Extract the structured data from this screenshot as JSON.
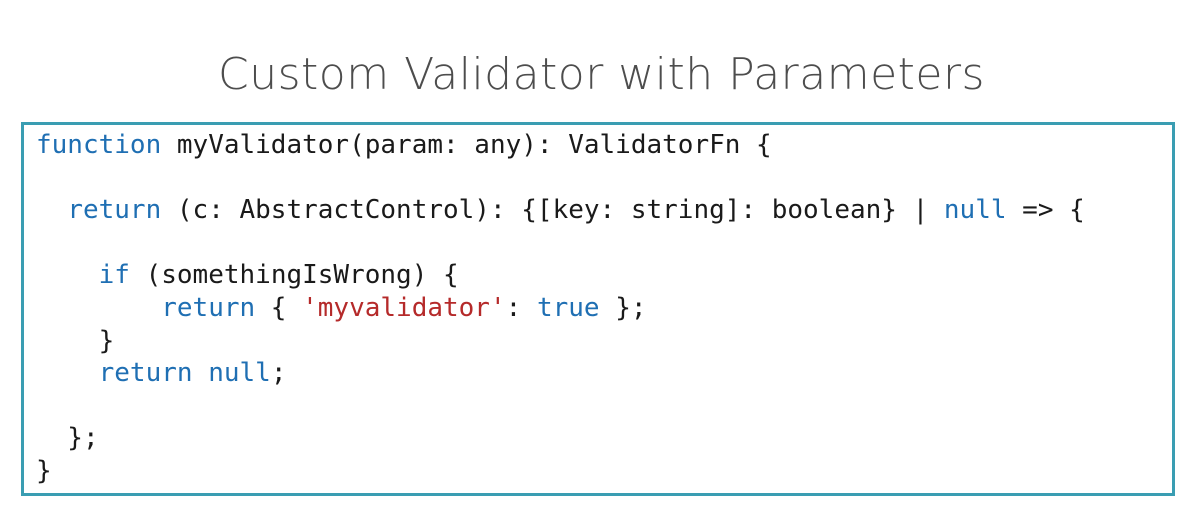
{
  "slide": {
    "title": "Custom Validator with Parameters"
  },
  "code": {
    "lines": [
      [
        {
          "t": "function",
          "c": "kw"
        },
        {
          "t": " myValidator(param: any): ValidatorFn {",
          "c": ""
        }
      ],
      [],
      [
        {
          "t": "  ",
          "c": ""
        },
        {
          "t": "return",
          "c": "kw"
        },
        {
          "t": " (c: AbstractControl): {[key: string]: boolean} | ",
          "c": ""
        },
        {
          "t": "null",
          "c": "kw"
        },
        {
          "t": " => {",
          "c": ""
        }
      ],
      [],
      [
        {
          "t": "    ",
          "c": ""
        },
        {
          "t": "if",
          "c": "kw"
        },
        {
          "t": " (somethingIsWrong) {",
          "c": ""
        }
      ],
      [
        {
          "t": "        ",
          "c": ""
        },
        {
          "t": "return",
          "c": "kw"
        },
        {
          "t": " { ",
          "c": ""
        },
        {
          "t": "'myvalidator'",
          "c": "str"
        },
        {
          "t": ": ",
          "c": ""
        },
        {
          "t": "true",
          "c": "kw"
        },
        {
          "t": " };",
          "c": ""
        }
      ],
      [
        {
          "t": "    }",
          "c": ""
        }
      ],
      [
        {
          "t": "    ",
          "c": ""
        },
        {
          "t": "return",
          "c": "kw"
        },
        {
          "t": " ",
          "c": ""
        },
        {
          "t": "null",
          "c": "kw"
        },
        {
          "t": ";",
          "c": ""
        }
      ],
      [],
      [
        {
          "t": "  };",
          "c": ""
        }
      ],
      [
        {
          "t": "}",
          "c": ""
        }
      ]
    ]
  },
  "colors": {
    "keyword": "#1f6fb3",
    "string": "#b52a2a",
    "text": "#1a1a1a",
    "border": "#3a9db2",
    "title": "#4d4d4d"
  }
}
